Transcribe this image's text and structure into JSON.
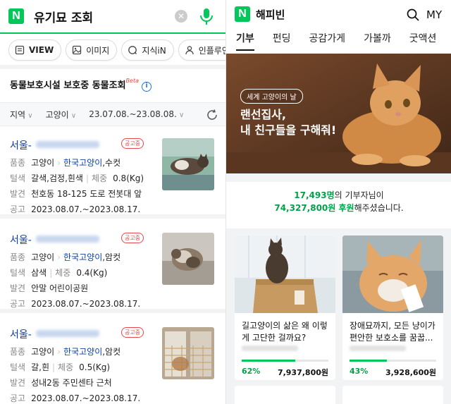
{
  "left": {
    "search": {
      "query": "유기묘 조회",
      "clear_icon": "clear-icon",
      "mic_icon": "mic-icon",
      "brand_color": "#03c75a"
    },
    "chips": [
      {
        "label": "VIEW",
        "icon": "view-icon"
      },
      {
        "label": "이미지",
        "icon": "image-icon"
      },
      {
        "label": "지식iN",
        "icon": "kin-icon"
      },
      {
        "label": "인플루언서",
        "icon": "person-icon"
      }
    ],
    "section_title": "동물보호시설 보호중 동물조회",
    "section_badge": "Beta",
    "filters": {
      "region": "지역",
      "species": "고양이",
      "period": "23.07.08.~23.08.08."
    },
    "items": [
      {
        "loc": "서울-",
        "badge": "공고중",
        "kind_label": "품종",
        "kind": "고양이",
        "breed": "한국고양이",
        "sex": ",수컷",
        "color_label": "털색",
        "color": "갈색,검정,흰색",
        "weight_label": "체중",
        "weight": "0.8(Kg)",
        "found_label": "발견",
        "found": "천호동 18-125 도로 전봇대 앞",
        "notice_label": "공고",
        "notice": "2023.08.07.~2023.08.17."
      },
      {
        "loc": "서울-",
        "badge": "공고중",
        "kind_label": "품종",
        "kind": "고양이",
        "breed": "한국고양이",
        "sex": ",암컷",
        "color_label": "털색",
        "color": "삼색",
        "weight_label": "체중",
        "weight": "0.4(Kg)",
        "found_label": "발견",
        "found": "안말 어린이공원",
        "notice_label": "공고",
        "notice": "2023.08.07.~2023.08.17."
      },
      {
        "loc": "서울-",
        "badge": "공고중",
        "kind_label": "품종",
        "kind": "고양이",
        "breed": "한국고양이",
        "sex": ",암컷",
        "color_label": "털색",
        "color": "갈,흰",
        "weight_label": "체중",
        "weight": "0.5(Kg)",
        "found_label": "발견",
        "found": "성내2동 주민센타 근처",
        "notice_label": "공고",
        "notice": "2023.08.07.~2023.08.17."
      }
    ]
  },
  "right": {
    "app_name": "해피빈",
    "my": "MY",
    "tabs": [
      "기부",
      "펀딩",
      "공감가게",
      "가볼까",
      "굿액션"
    ],
    "hero": {
      "badge": "세계 고양이의 날",
      "title_line1": "랜선집사,",
      "title_line2": "내 친구들을 구해줘!"
    },
    "stats": {
      "donors": "17,493명",
      "donors_suffix": "의 기부자님이",
      "amount": "74,327,800원 후원",
      "amount_suffix": "해주셨습니다."
    },
    "cards": [
      {
        "title": "길고양이의 삶은 왜 이렇게 고단한 걸까요?",
        "percent": "62%",
        "progress": 0.62,
        "amount": "7,937,800원"
      },
      {
        "title": "장애묘까지, 모든 냥이가 편안한 보호소를 꿈꿉...",
        "percent": "43%",
        "progress": 0.43,
        "amount": "3,928,600원"
      }
    ]
  }
}
